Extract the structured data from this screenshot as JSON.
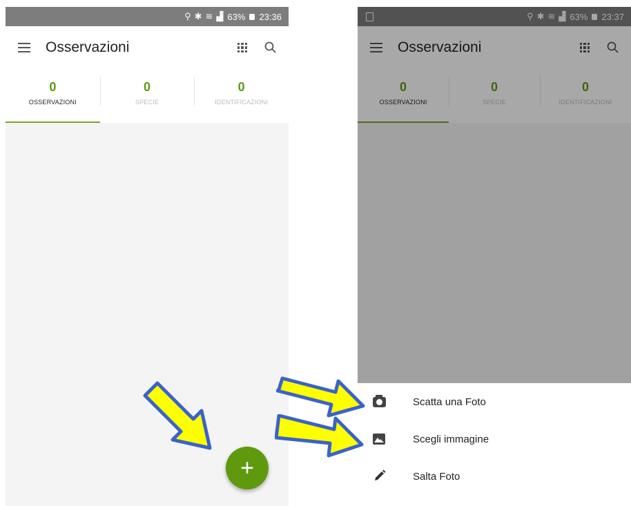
{
  "app": {
    "title": "Osservazioni"
  },
  "left_screen": {
    "status": {
      "battery": "63%",
      "time": "23:36"
    },
    "tabs": [
      {
        "count": "0",
        "label": "OSSERVAZIONI"
      },
      {
        "count": "0",
        "label": "SPECIE"
      },
      {
        "count": "0",
        "label": "IDENTIFICAZIONI"
      }
    ],
    "fab": {
      "label": "+"
    }
  },
  "right_screen": {
    "status": {
      "battery": "63%",
      "time": "23:37"
    },
    "tabs": [
      {
        "count": "0",
        "label": "OSSERVAZIONI"
      },
      {
        "count": "0",
        "label": "SPECIE"
      },
      {
        "count": "0",
        "label": "IDENTIFICAZIONI"
      }
    ],
    "sheet": {
      "items": [
        {
          "label": "Scatta una Foto",
          "icon": "camera-icon"
        },
        {
          "label": "Scegli immagine",
          "icon": "image-icon"
        },
        {
          "label": "Salta Foto",
          "icon": "pencil-icon"
        }
      ]
    }
  },
  "colors": {
    "accent": "#5f9a0e",
    "arrow_fill": "#ffff00",
    "arrow_stroke": "#3a63c9"
  },
  "icons": [
    "menu-icon",
    "grid-view-icon",
    "search-icon",
    "location-icon",
    "bluetooth-icon",
    "wifi-icon",
    "signal-icon",
    "battery-icon"
  ]
}
